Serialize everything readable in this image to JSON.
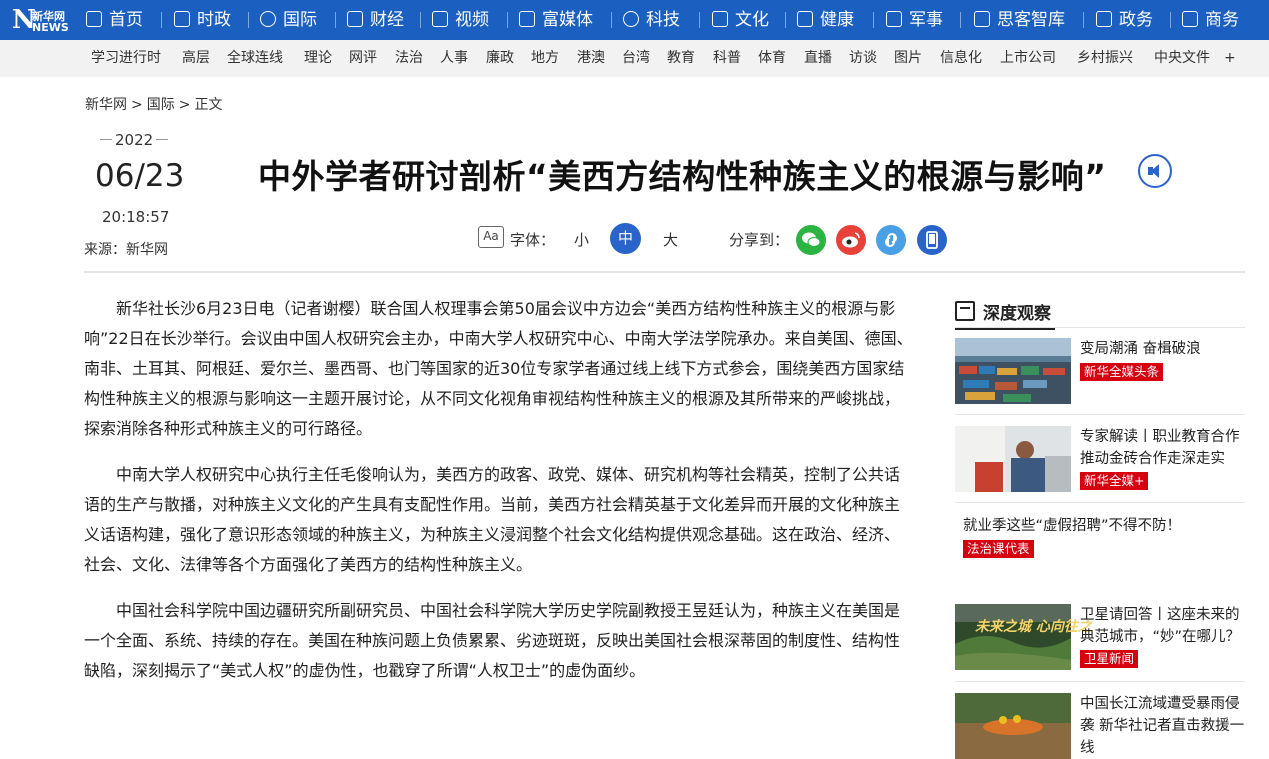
{
  "logo": {
    "latin": "N",
    "cn": "新华网",
    "ws": "NEWS"
  },
  "topnav": [
    {
      "label": "首页",
      "icon": "home-icon"
    },
    {
      "label": "时政",
      "icon": "document-icon"
    },
    {
      "label": "国际",
      "icon": "globe-icon"
    },
    {
      "label": "财经",
      "icon": "chart-icon"
    },
    {
      "label": "视频",
      "icon": "play-icon"
    },
    {
      "label": "富媒体",
      "icon": "grid-icon"
    },
    {
      "label": "科技",
      "icon": "gear-icon"
    },
    {
      "label": "文化",
      "icon": "book-icon"
    },
    {
      "label": "健康",
      "icon": "heart-monitor-icon"
    },
    {
      "label": "军事",
      "icon": "shield-icon"
    },
    {
      "label": "思客智库",
      "icon": "chat-icon"
    },
    {
      "label": "政务",
      "icon": "building-icon"
    },
    {
      "label": "商务",
      "icon": "briefcase-icon"
    }
  ],
  "subnav": [
    "学习进行时",
    "高层",
    "全球连线",
    "理论",
    "网评",
    "法治",
    "人事",
    "廉政",
    "地方",
    "港澳",
    "台湾",
    "教育",
    "科普",
    "体育",
    "直播",
    "访谈",
    "图片",
    "信息化",
    "上市公司",
    "乡村振兴",
    "中央文件",
    "+"
  ],
  "breadcrumb": {
    "home": "新华网",
    "sep": ">",
    "section": "国际",
    "current": "正文"
  },
  "date": {
    "year": "2022",
    "monthday": "06/23",
    "time": "20:18:57"
  },
  "source": "来源：新华网",
  "title": "中外学者研讨剖析“美西方结构性种族主义的根源与影响”",
  "tools": {
    "font_icon": "Aa",
    "font_label": "字体：",
    "small": "小",
    "medium": "中",
    "large": "大",
    "share_label": "分享到："
  },
  "share": [
    {
      "name": "wechat-icon",
      "color": "#2bb441"
    },
    {
      "name": "weibo-icon",
      "color": "#e8413a"
    },
    {
      "name": "link-icon",
      "color": "#4aa0e6"
    },
    {
      "name": "mobile-icon",
      "color": "#2a63c9"
    }
  ],
  "paragraphs": [
    "新华社长沙6月23日电（记者谢樱）联合国人权理事会第50届会议中方边会“美西方结构性种族主义的根源与影响”22日在长沙举行。会议由中国人权研究会主办，中南大学人权研究中心、中南大学法学院承办。来自美国、德国、南非、土耳其、阿根廷、爱尔兰、墨西哥、也门等国家的近30位专家学者通过线上线下方式参会，围绕美西方国家结构性种族主义的根源与影响这一主题开展讨论，从不同文化视角审视结构性种族主义的根源及其所带来的严峻挑战，探索消除各种形式种族主义的可行路径。",
    "中南大学人权研究中心执行主任毛俊响认为，美西方的政客、政党、媒体、研究机构等社会精英，控制了公共话语的生产与散播，对种族主义文化的产生具有支配性作用。当前，美西方社会精英基于文化差异而开展的文化种族主义话语构建，强化了意识形态领域的种族主义，为种族主义浸润整个社会文化结构提供观念基础。这在政治、经济、社会、文化、法律等各个方面强化了美西方的结构性种族主义。",
    "中国社会科学院中国边疆研究所副研究员、中国社会科学院大学历史学院副教授王昱廷认为，种族主义在美国是一个全面、系统、持续的存在。美国在种族问题上负债累累、劣迹斑斑，反映出美国社会根深蒂固的制度性、结构性缺陷，深刻揭示了“美式人权”的虚伪性，也戳穿了所谓“人权卫士”的虚伪面纱。"
  ],
  "sidebar": {
    "heading": "深度观察",
    "cards": [
      {
        "title": "变局潮涌 奋楫破浪",
        "tag": "新华全媒头条"
      },
      {
        "title": "专家解读丨职业教育合作推动金砖合作走深走实",
        "tag": "新华全媒+"
      },
      {
        "title": "就业季这些“虚假招聘”不得不防！",
        "tag": "法治课代表"
      },
      {
        "title": "卫星请回答丨这座未来的典范城市，“妙”在哪儿？",
        "tag": "卫星新闻",
        "thumb_text": "未来之城 心向往之"
      },
      {
        "title": "中国长江流域遭受暴雨侵袭 新华社记者直击救援一线",
        "tag": ""
      }
    ]
  }
}
